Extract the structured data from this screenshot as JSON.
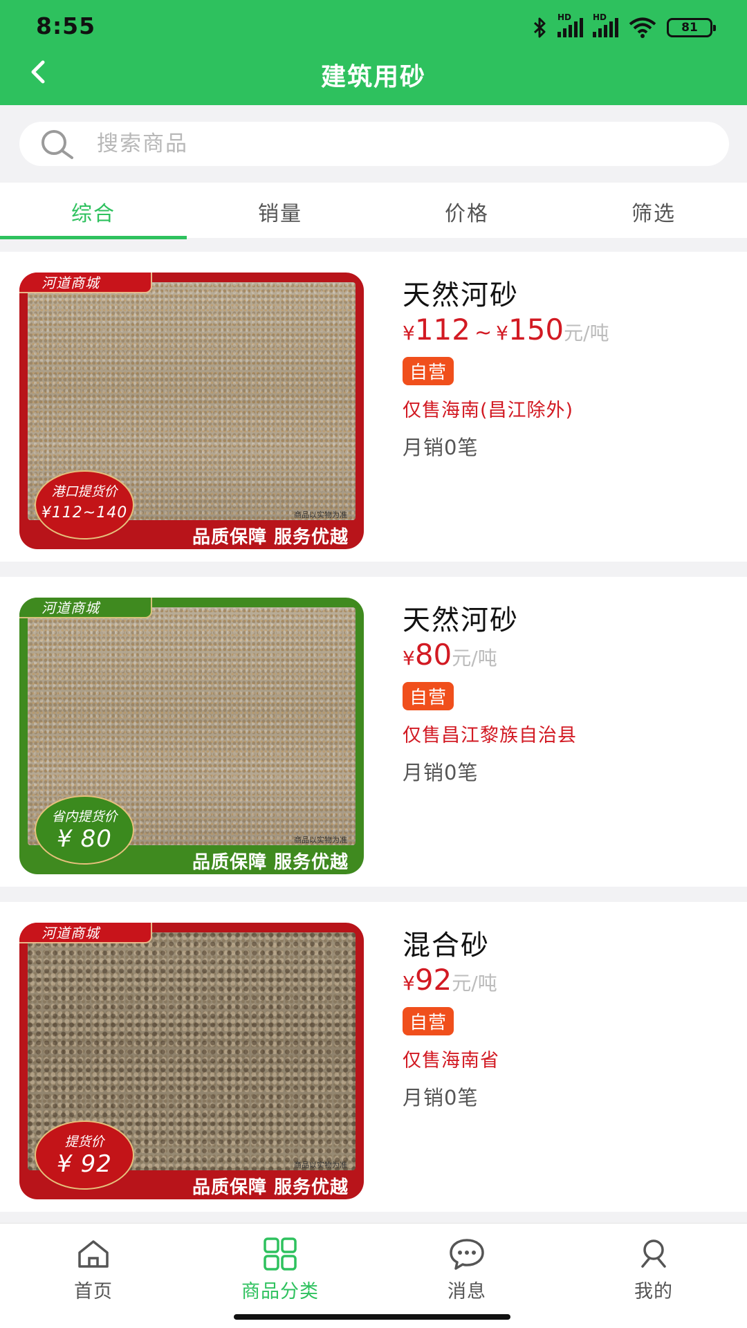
{
  "status_bar": {
    "time": "8:55",
    "battery": "81",
    "signal_labels": [
      "HD",
      "HD"
    ]
  },
  "header": {
    "title": "建筑用砂"
  },
  "search": {
    "placeholder": "搜索商品"
  },
  "sort_tabs": [
    {
      "label": "综合",
      "active": true
    },
    {
      "label": "销量",
      "active": false
    },
    {
      "label": "价格",
      "active": false
    },
    {
      "label": "筛选",
      "active": false
    }
  ],
  "products": [
    {
      "name": "天然河砂",
      "currency": "¥",
      "price_low": "112",
      "price_sep": "~",
      "price_high": "150",
      "unit": "元/吨",
      "tag": "自营",
      "region": "仅售海南(昌江除外)",
      "sales": "月销0笔",
      "image": {
        "shop_tag": "河道商城",
        "badge_label": "港口提货价",
        "badge_value": "¥112~140",
        "slogan": "品质保障 服务优越",
        "note": "商品以实物为准",
        "theme_color": "#b8141a"
      }
    },
    {
      "name": "天然河砂",
      "currency": "¥",
      "price": "80",
      "unit": "元/吨",
      "tag": "自营",
      "region": "仅售昌江黎族自治县",
      "sales": "月销0笔",
      "image": {
        "shop_tag": "河道商城",
        "badge_label": "省内提货价",
        "badge_value": "¥ 80",
        "slogan": "品质保障 服务优越",
        "note": "商品以实物为准",
        "theme_color": "#3f8a1f"
      }
    },
    {
      "name": "混合砂",
      "currency": "¥",
      "price": "92",
      "unit": "元/吨",
      "tag": "自营",
      "region": "仅售海南省",
      "sales": "月销0笔",
      "image": {
        "shop_tag": "河道商城",
        "badge_label": "提货价",
        "badge_value": "¥ 92",
        "slogan": "品质保障 服务优越",
        "note": "商品以实物为准",
        "theme_color": "#b8141a"
      }
    }
  ],
  "bottom_nav": [
    {
      "label": "首页",
      "icon": "home-icon",
      "active": false
    },
    {
      "label": "商品分类",
      "icon": "category-grid-icon",
      "active": true
    },
    {
      "label": "消息",
      "icon": "chat-bubble-icon",
      "active": false
    },
    {
      "label": "我的",
      "icon": "user-icon",
      "active": false
    }
  ],
  "colors": {
    "brand_green": "#2ec15e",
    "price_red": "#d21a23",
    "self_badge": "#f04f1c"
  }
}
